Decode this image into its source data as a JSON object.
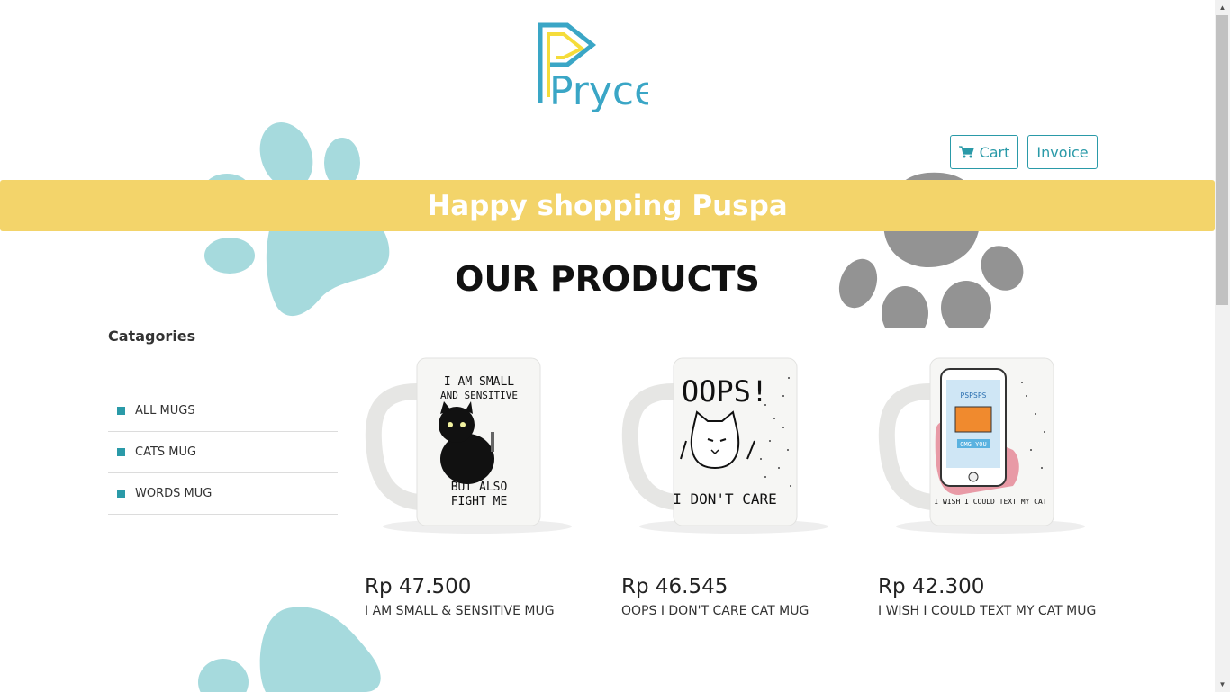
{
  "header": {
    "logo_text": "Pryce!",
    "cart_label": "Cart",
    "invoice_label": "Invoice"
  },
  "banner": {
    "text": "Happy shopping Puspa"
  },
  "main": {
    "section_title": "OUR PRODUCTS"
  },
  "sidebar": {
    "title": "Catagories",
    "items": [
      {
        "label": "ALL MUGS"
      },
      {
        "label": "CATS MUG"
      },
      {
        "label": "WORDS MUG"
      }
    ]
  },
  "products": [
    {
      "price": "Rp 47.500",
      "name": "I AM SMALL & SENSITIVE MUG",
      "mug_top_text": "I AM SMALL",
      "mug_top_text2": "AND SENSITIVE",
      "mug_bottom_text": "BUT ALSO",
      "mug_bottom_text2": "FIGHT ME"
    },
    {
      "price": "Rp 46.545",
      "name": "OOPS I DON'T CARE CAT MUG",
      "mug_top_text": "OOPS!",
      "mug_bottom_text": "I DON'T CARE"
    },
    {
      "price": "Rp 42.300",
      "name": "I WISH I COULD TEXT MY CAT MUG",
      "mug_bottom_text": "I WISH I COULD TEXT MY CAT",
      "mug_screen_text": "PSPSPS",
      "mug_button_text": "OMG YOU"
    }
  ],
  "colors": {
    "accent": "#2a9aa8",
    "banner": "#f3d46a",
    "paw_teal": "#a6dadd",
    "paw_gray": "#939393",
    "logo_yellow": "#f5dc3a"
  }
}
